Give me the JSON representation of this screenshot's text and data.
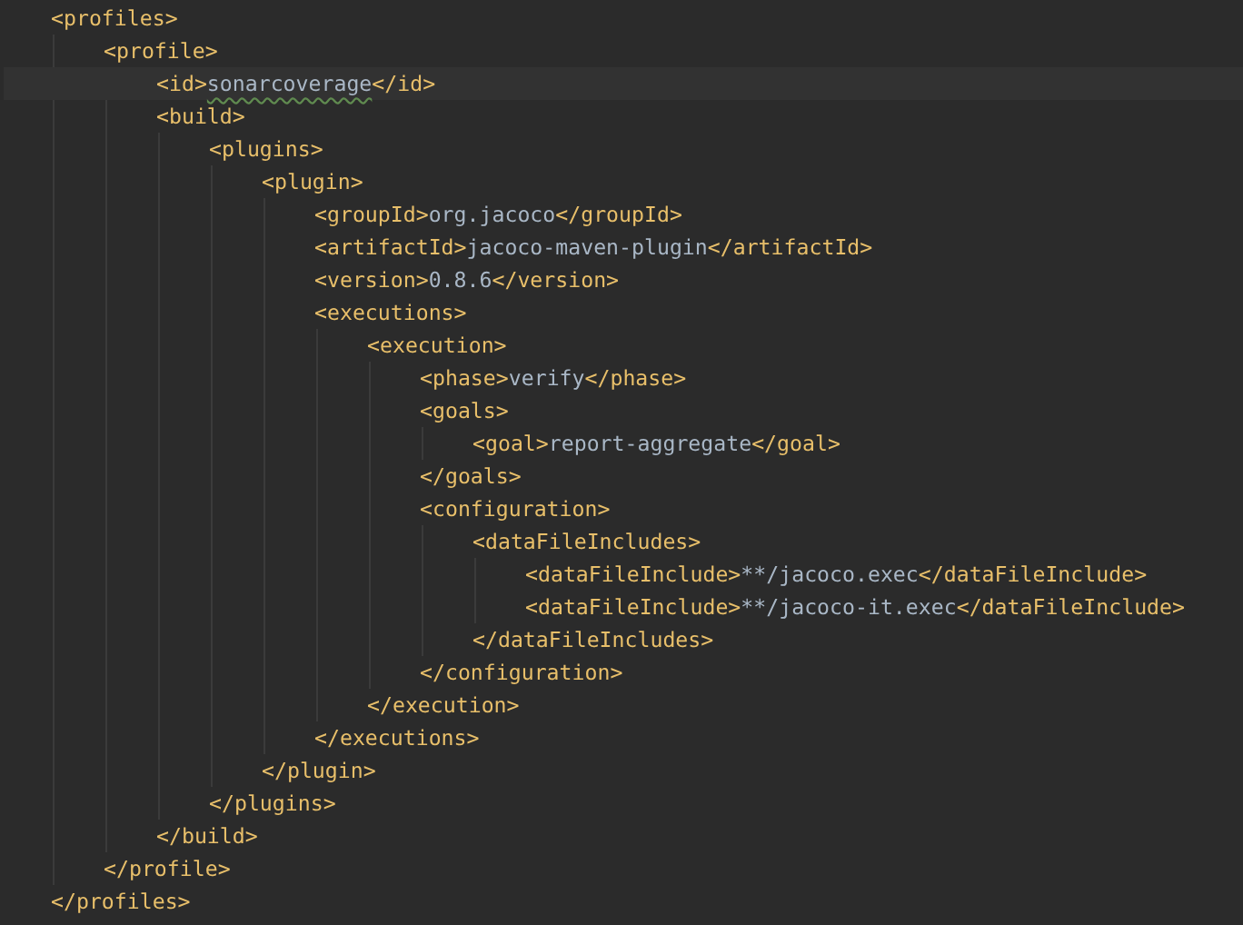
{
  "editor": {
    "lines": [
      {
        "text": "<profiles>",
        "children": [
          {
            "text": "<profile>",
            "children": [
              {
                "text": "<id>sonarcoverage</id>",
                "current": true,
                "spelling_warning": true
              },
              {
                "text": "<build>",
                "children": [
                  {
                    "text": "<plugins>",
                    "children": [
                      {
                        "text": "<plugin>",
                        "children": [
                          {
                            "text": "<groupId>org.jacoco</groupId>"
                          },
                          {
                            "text": "<artifactId>jacoco-maven-plugin</artifactId>"
                          },
                          {
                            "text": "<version>0.8.6</version>"
                          },
                          {
                            "text": "<executions>",
                            "children": [
                              {
                                "text": "<execution>",
                                "children": [
                                  {
                                    "text": "<phase>verify</phase>"
                                  },
                                  {
                                    "text": "<goals>",
                                    "children": [
                                      {
                                        "text": "<goal>report-aggregate</goal>"
                                      }
                                    ]
                                  },
                                  {
                                    "text": "</goals>"
                                  },
                                  {
                                    "text": "<configuration>",
                                    "children": [
                                      {
                                        "text": "<dataFileIncludes>",
                                        "children": [
                                          {
                                            "text": "<dataFileInclude>**/jacoco.exec</dataFileInclude>"
                                          },
                                          {
                                            "text": "<dataFileInclude>**/jacoco-it.exec</dataFileInclude>"
                                          }
                                        ]
                                      },
                                      {
                                        "text": "</dataFileIncludes>"
                                      }
                                    ]
                                  },
                                  {
                                    "text": "</configuration>"
                                  }
                                ]
                              },
                              {
                                "text": "</execution>"
                              }
                            ]
                          },
                          {
                            "text": "</executions>"
                          }
                        ]
                      },
                      {
                        "text": "</plugin>"
                      }
                    ]
                  },
                  {
                    "text": "</plugins>"
                  }
                ]
              },
              {
                "text": "</build>"
              }
            ]
          },
          {
            "text": "</profile>"
          }
        ]
      },
      {
        "text": "</profiles>"
      }
    ]
  }
}
